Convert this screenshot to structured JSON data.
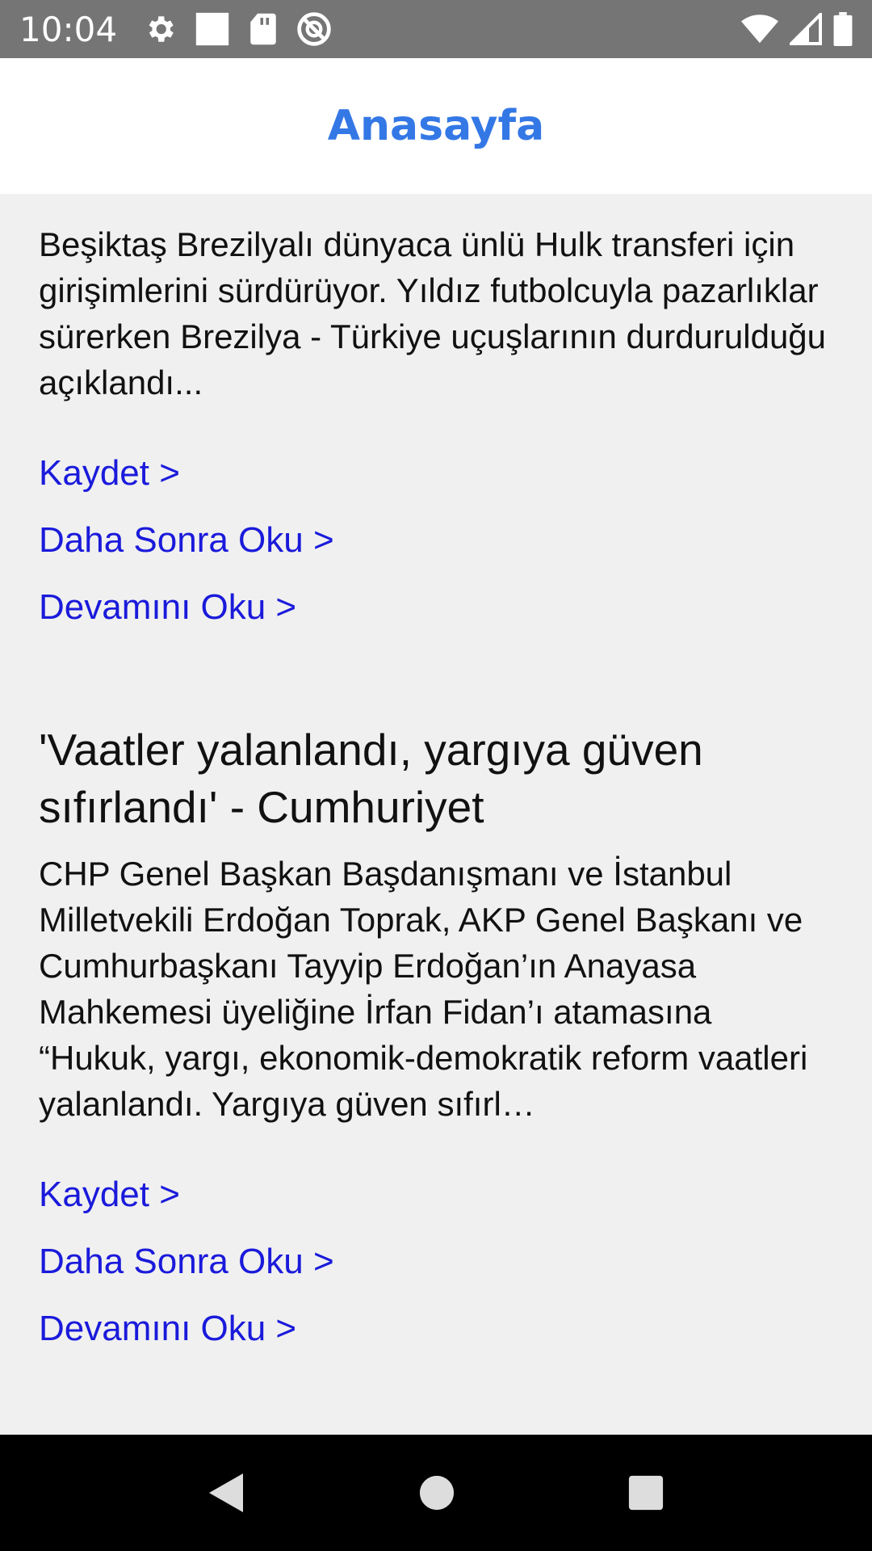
{
  "status_bar": {
    "time": "10:04",
    "icons_left": [
      "gear-icon",
      "square-notification-icon",
      "sd-card-icon",
      "no-sync-icon"
    ],
    "icons_right": [
      "wifi-icon",
      "signal-icon",
      "battery-icon"
    ]
  },
  "app_bar": {
    "title": "Anasayfa",
    "title_color": "#3478e6"
  },
  "articles": [
    {
      "summary": "Beşiktaş Brezilyalı dünyaca ünlü Hulk transferi için girişimlerini sürdürüyor. Yıldız futbolcuyla pazarlıklar sürerken Brezilya - Türkiye uçuşlarının durdurulduğu açıklandı...",
      "save_label": "Kaydet >",
      "read_later_label": "Daha Sonra Oku >",
      "read_more_label": "Devamını Oku >"
    },
    {
      "title": "'Vaatler yalanlandı, yargıya güven sıfırlandı' - Cumhuriyet",
      "summary": "CHP Genel Başkan Başdanışmanı ve İstanbul Milletvekili Erdoğan Toprak, AKP Genel Başkanı ve Cumhurbaşkanı Tayyip Erdoğan’ın Anayasa Mahkemesi üyeliğine İrfan Fidan’ı atamasına “Hukuk, yargı, ekonomik-demokratik reform vaatleri yalanlandı. Yargıya güven sıfırl…",
      "save_label": "Kaydet >",
      "read_later_label": "Daha Sonra Oku >",
      "read_more_label": "Devamını Oku >"
    }
  ],
  "link_color": "#1a1adb",
  "nav_bar": {
    "buttons": [
      "back-icon",
      "home-icon",
      "recents-icon"
    ]
  }
}
